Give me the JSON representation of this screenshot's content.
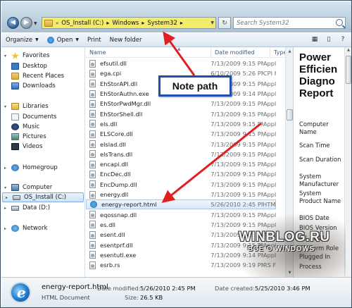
{
  "address": {
    "crumbs": [
      "OS_Install (C:)",
      "Windows",
      "System32"
    ],
    "lead_chevrons": "«"
  },
  "search": {
    "placeholder": "Search System32"
  },
  "toolbar": {
    "organize": "Organize",
    "open": "Open",
    "print": "Print",
    "new_folder": "New folder"
  },
  "nav": {
    "favorites": "Favorites",
    "desktop": "Desktop",
    "recent_places": "Recent Places",
    "downloads": "Downloads",
    "libraries": "Libraries",
    "documents": "Documents",
    "music": "Music",
    "pictures": "Pictures",
    "videos": "Videos",
    "homegroup": "Homegroup",
    "computer": "Computer",
    "os_install": "OS_Install (C:)",
    "data": "Data (D:)",
    "network": "Network"
  },
  "columns": {
    "name": "Name",
    "date": "Date modified",
    "type": "Type"
  },
  "files": [
    {
      "name": "efsutil.dll",
      "date": "7/13/2009 9:15 PM",
      "type": "Appl"
    },
    {
      "name": "ega.cpi",
      "date": "6/10/2009 5:26 PM",
      "type": "CPI F"
    },
    {
      "name": "EhStorAPI.dll",
      "date": "7/13/2009 9:15 PM",
      "type": "Appl"
    },
    {
      "name": "EhStorAuthn.exe",
      "date": "7/13/2009 9:14 PM",
      "type": "Appl"
    },
    {
      "name": "EhStorPwdMgr.dll",
      "date": "7/13/2009 9:15 PM",
      "type": "Appl"
    },
    {
      "name": "EhStorShell.dll",
      "date": "7/13/2009 9:15 PM",
      "type": "Appl"
    },
    {
      "name": "els.dll",
      "date": "7/13/2009 9:15 PM",
      "type": "Appl"
    },
    {
      "name": "ELSCore.dll",
      "date": "7/13/2009 9:15 PM",
      "type": "Appl"
    },
    {
      "name": "elslad.dll",
      "date": "7/13/2009 9:15 PM",
      "type": "Appl"
    },
    {
      "name": "elsTrans.dll",
      "date": "7/13/2009 9:15 PM",
      "type": "Appl"
    },
    {
      "name": "encapi.dll",
      "date": "7/13/2009 9:15 PM",
      "type": "Appl"
    },
    {
      "name": "EncDec.dll",
      "date": "7/13/2009 9:15 PM",
      "type": "Appl"
    },
    {
      "name": "EncDump.dll",
      "date": "7/13/2009 9:15 PM",
      "type": "Appl"
    },
    {
      "name": "energy.dll",
      "date": "7/13/2009 9:15 PM",
      "type": "Appl"
    },
    {
      "name": "energy-report.html",
      "date": "5/26/2010 2:45 PM",
      "type": "HTM"
    },
    {
      "name": "eqossnap.dll",
      "date": "7/13/2009 9:15 PM",
      "type": "Appl"
    },
    {
      "name": "es.dll",
      "date": "7/13/2009 9:15 PM",
      "type": "Appl"
    },
    {
      "name": "esent.dll",
      "date": "7/13/2009 9:15 PM",
      "type": "Appl"
    },
    {
      "name": "esentprf.dll",
      "date": "7/13/2009 9:15 PM",
      "type": "Appl"
    },
    {
      "name": "esentutl.exe",
      "date": "7/13/2009 9:14 PM",
      "type": "Appl"
    },
    {
      "name": "esrb.rs",
      "date": "7/13/2009 9:19 PM",
      "type": "RS Fi"
    }
  ],
  "preview": {
    "title_lines": [
      "Power",
      "Efficien",
      "Diagno",
      "Report"
    ],
    "fields": [
      "Computer Name",
      "Scan Time",
      "Scan Duration",
      "System Manufacturer",
      "System Product Name",
      "BIOS Date",
      "BIOS Version",
      "OS Build",
      "Platform Role",
      "Plugged In",
      "Process"
    ]
  },
  "details": {
    "filename": "energy-report.html",
    "type": "HTML Document",
    "date_modified_label": "Date modified:",
    "date_modified": "5/26/2010 2:45 PM",
    "size_label": "Size:",
    "size": "26.5 KB",
    "date_created_label": "Date created:",
    "date_created": "5/25/2010 3:46 PM"
  },
  "annotation": {
    "callout": "Note path"
  },
  "watermark": {
    "line1": "WINBLOG.RU",
    "line2": "ВСЁ О WINDOWS"
  },
  "colors": {
    "address_highlight": "#f2ec68",
    "arrow": "#e02020",
    "callout_border": "#1f4fa8"
  }
}
